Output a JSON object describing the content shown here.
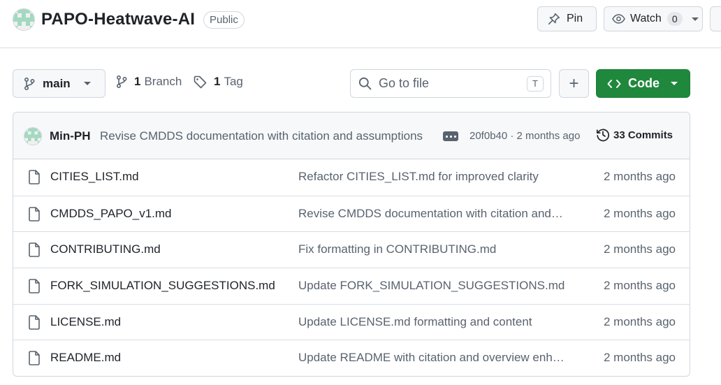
{
  "repo": {
    "name": "PAPO-Heatwave-AI",
    "visibility": "Public"
  },
  "header_actions": {
    "pin_label": "Pin",
    "watch_label": "Watch",
    "watch_count": "0"
  },
  "toolbar": {
    "branch": "main",
    "branches_count": "1",
    "branches_label": "Branch",
    "tags_count": "1",
    "tags_label": "Tag",
    "search_placeholder": "Go to file",
    "search_shortcut": "T",
    "add_label": "+",
    "code_label": "Code"
  },
  "latest_commit": {
    "author": "Min-PH",
    "message": "Revise CMDDS documentation with citation and assumptions",
    "hash_age": "20f0b40 · 2 months ago",
    "commits_label": "33 Commits"
  },
  "files": [
    {
      "name": "CITIES_LIST.md",
      "message": "Refactor CITIES_LIST.md for improved clarity",
      "age": "2 months ago"
    },
    {
      "name": "CMDDS_PAPO_v1.md",
      "message": "Revise CMDDS documentation with citation and assumptions",
      "age": "2 months ago"
    },
    {
      "name": "CONTRIBUTING.md",
      "message": "Fix formatting in CONTRIBUTING.md",
      "age": "2 months ago"
    },
    {
      "name": "FORK_SIMULATION_SUGGESTIONS.md",
      "message": "Update FORK_SIMULATION_SUGGESTIONS.md",
      "age": "2 months ago"
    },
    {
      "name": "LICENSE.md",
      "message": "Update LICENSE.md formatting and content",
      "age": "2 months ago"
    },
    {
      "name": "README.md",
      "message": "Update README with citation and overview enhancements",
      "age": "2 months ago"
    }
  ],
  "icons": {
    "avatar": "identicon",
    "pin": "pin-icon",
    "watch": "eye-icon",
    "branch": "git-branch-icon",
    "tag": "tag-icon",
    "search": "search-icon",
    "code": "code-icon",
    "history": "history-icon",
    "file": "file-icon"
  },
  "colors": {
    "accent_green": "#1f883d",
    "muted_text": "#59636e",
    "border": "#d0d7de",
    "avatar_mint": "#a3d9c0"
  }
}
